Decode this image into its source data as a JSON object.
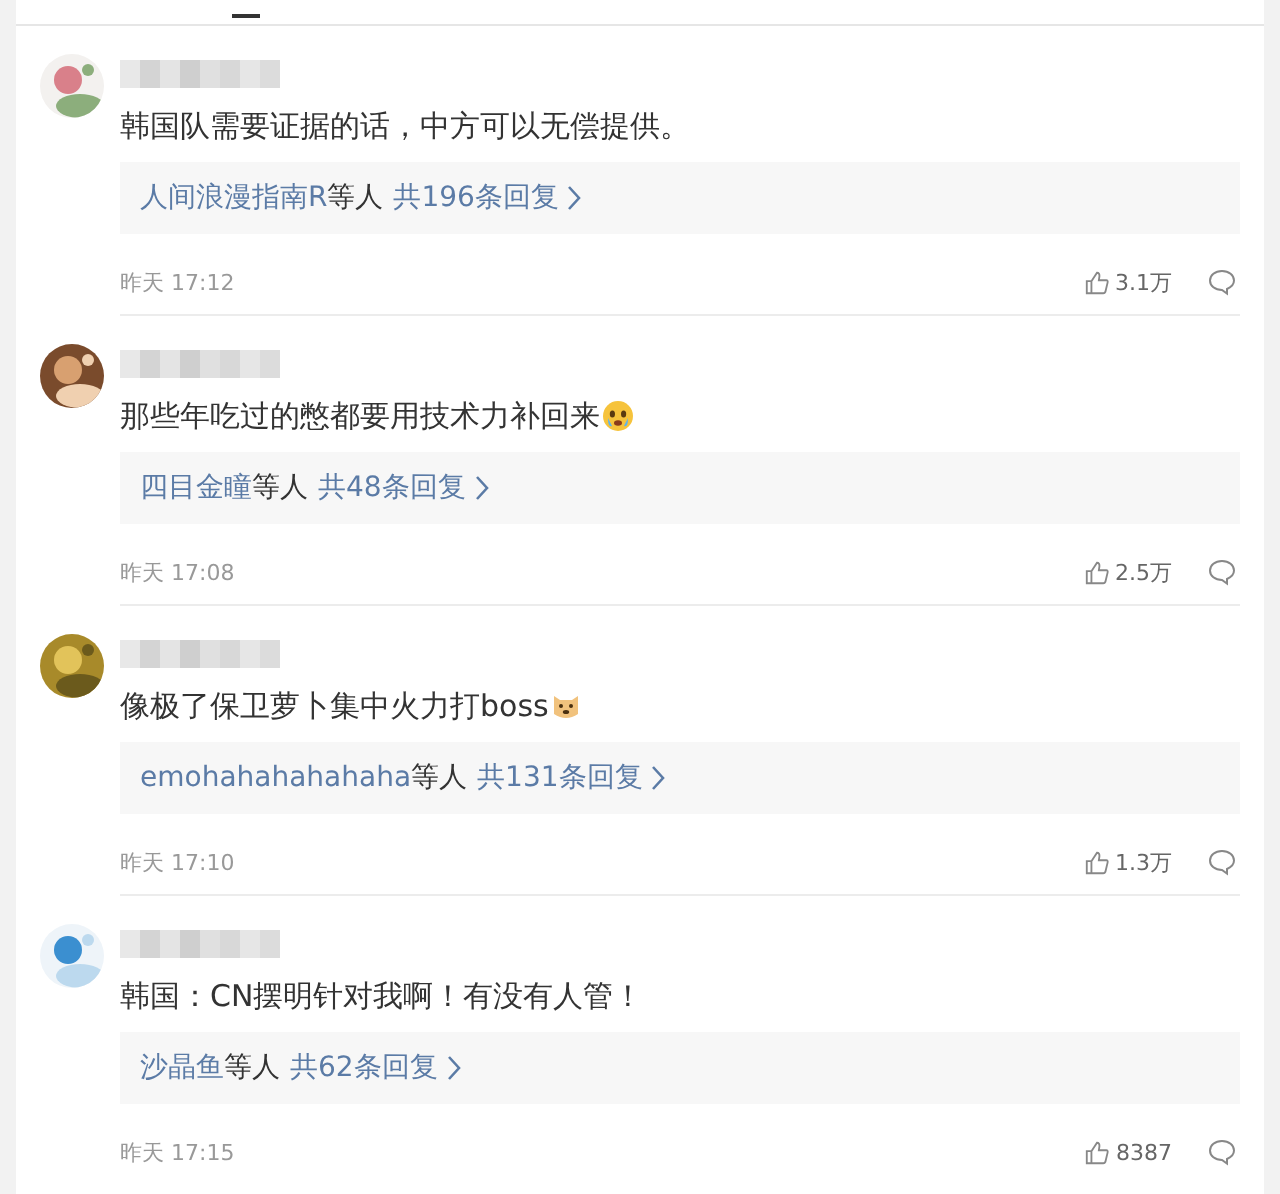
{
  "comments": [
    {
      "text": "韩国队需要证据的话，中方可以无偿提供。",
      "replies": {
        "user": "人间浪漫指南R",
        "suffix": "等人",
        "count": "共196条回复"
      },
      "time": "昨天 17:12",
      "likes": "3.1万"
    },
    {
      "emoji": {
        "kind": "crying"
      },
      "text": "那些年吃过的憋都要用技术力补回来",
      "replies": {
        "user": "四目金瞳",
        "suffix": "等人",
        "count": "共48条回复"
      },
      "time": "昨天 17:08",
      "likes": "2.5万"
    },
    {
      "emoji": {
        "kind": "dog"
      },
      "text": "像极了保卫萝卜集中火力打boss",
      "replies": {
        "user": "emohahahahahaha",
        "suffix": "等人",
        "count": "共131条回复"
      },
      "time": "昨天 17:10",
      "likes": "1.3万"
    },
    {
      "text": "韩国：CN摆明针对我啊！有没有人管！",
      "replies": {
        "user": "沙晶鱼",
        "suffix": "等人",
        "count": "共62条回复"
      },
      "time": "昨天 17:15",
      "likes": "8387"
    }
  ]
}
